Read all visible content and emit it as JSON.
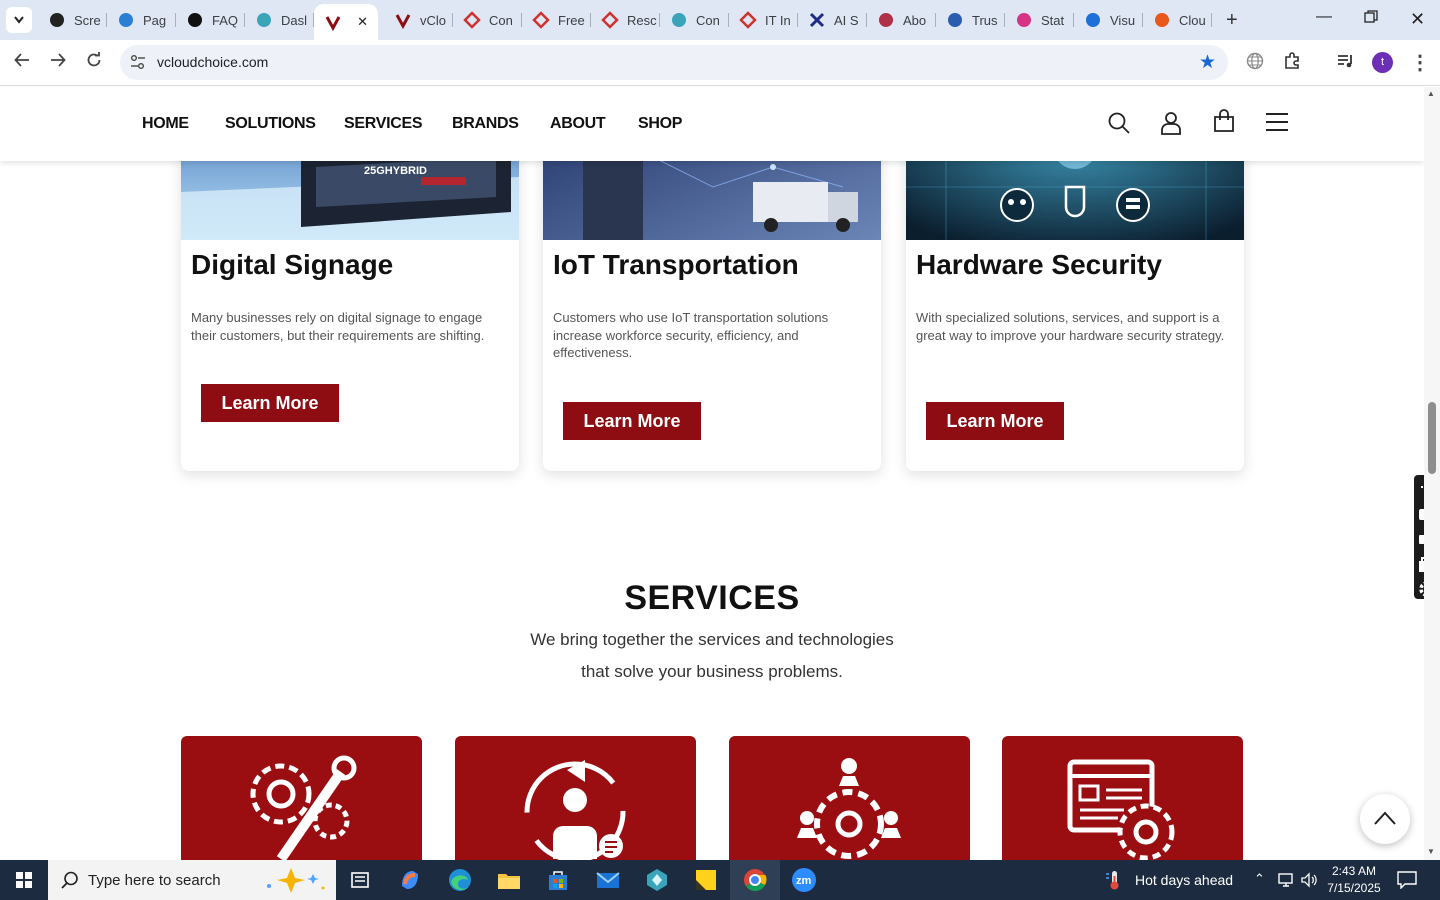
{
  "browser": {
    "tabs": [
      {
        "label": "Scre",
        "icon": "gear-favicon-icon"
      },
      {
        "label": "Pag",
        "icon": "speed-favicon-icon"
      },
      {
        "label": "FAQ",
        "icon": "openai-favicon-icon"
      },
      {
        "label": "Dasl",
        "icon": "teal-hex-favicon-icon"
      },
      {
        "label": "",
        "icon": "v-logo-favicon-icon",
        "active": true
      },
      {
        "label": "vClo",
        "icon": "v-logo-favicon-icon"
      },
      {
        "label": "Con",
        "icon": "red-diamond-favicon-icon"
      },
      {
        "label": "Free",
        "icon": "red-diamond-favicon-icon"
      },
      {
        "label": "Resc",
        "icon": "red-diamond-favicon-icon"
      },
      {
        "label": "Con",
        "icon": "teal-hex-favicon-icon"
      },
      {
        "label": "IT In",
        "icon": "red-diamond-favicon-icon"
      },
      {
        "label": "AI S",
        "icon": "x-favicon-icon"
      },
      {
        "label": "Abo",
        "icon": "pink-favicon-icon"
      },
      {
        "label": "Trus",
        "icon": "scale-favicon-icon"
      },
      {
        "label": "Stat",
        "icon": "pen-favicon-icon"
      },
      {
        "label": "Visu",
        "icon": "pulse-favicon-icon"
      },
      {
        "label": "Clou",
        "icon": "orange-stroke-favicon-icon"
      }
    ],
    "url": "vcloudchoice.com",
    "profile_initial": "t"
  },
  "site": {
    "menu": [
      "HOME",
      "SOLUTIONS",
      "SERVICES",
      "BRANDS",
      "ABOUT",
      "SHOP"
    ],
    "cards": [
      {
        "title": "Digital Signage",
        "description": "Many businesses rely on digital signage to engage their customers, but their requirements are shifting.",
        "button": "Learn More",
        "image_text": "25GHYBRID"
      },
      {
        "title": "IoT Transportation",
        "description": "Customers who use IoT transportation solutions increase workforce security, efficiency, and effectiveness.",
        "button": "Learn More"
      },
      {
        "title": "Hardware Security",
        "description": "With specialized solutions, services, and support is a great way to improve your hardware security strategy.",
        "button": "Learn More"
      }
    ],
    "services": {
      "title": "SERVICES",
      "subtitle_line1": "We bring together the services and technologies",
      "subtitle_line2": "that solve your business problems.",
      "icons": [
        "gear-wrench-icon",
        "consultant-megaphone-icon",
        "gear-team-icon",
        "webpage-gear-icon"
      ]
    },
    "colors": {
      "brand_red": "#8e0d12",
      "service_card": "#9a0e12"
    }
  },
  "taskbar": {
    "search_placeholder": "Type here to search",
    "weather": "Hot days ahead",
    "time": "2:43 AM",
    "date": "7/15/2025"
  }
}
